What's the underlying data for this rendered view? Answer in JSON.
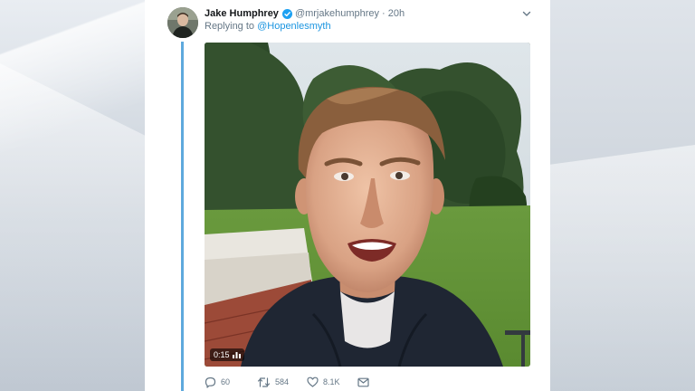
{
  "tweet": {
    "display_name": "Jake Humphrey",
    "handle": "@mrjakehumphrey",
    "separator": "·",
    "time": "20h",
    "replying_prefix": "Replying to ",
    "replying_to": "@Hopenlesmyth",
    "video_duration": "0:15",
    "stats": {
      "replies": "60",
      "retweets": "584",
      "likes": "8.1K"
    },
    "icons": {
      "verified": "verified-badge-icon",
      "caret": "chevron-down-icon",
      "reply": "reply-icon",
      "retweet": "retweet-icon",
      "like": "heart-icon",
      "dm": "envelope-icon",
      "video_stats": "bar-chart-icon"
    }
  },
  "colors": {
    "accent": "#1b95e0",
    "thread_line": "#5ea9dd",
    "text_primary": "#14171a",
    "text_secondary": "#657786",
    "card_bg": "#ffffff"
  }
}
